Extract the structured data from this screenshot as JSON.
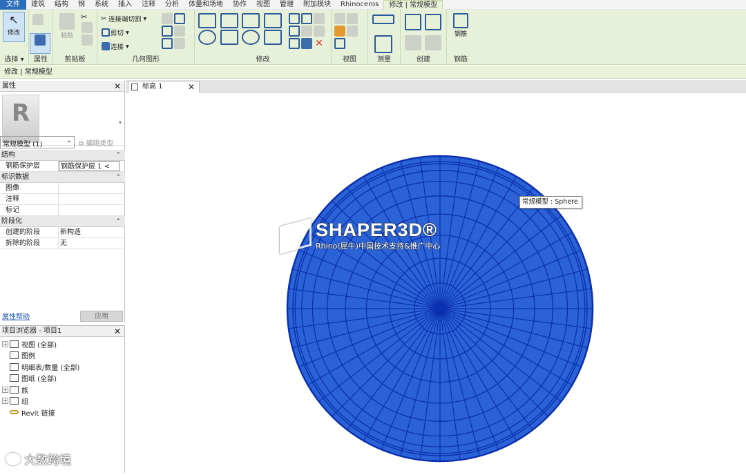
{
  "menubar": {
    "tabs": [
      "文件",
      "建筑",
      "结构",
      "钢",
      "系统",
      "插入",
      "注释",
      "分析",
      "体量和场地",
      "协作",
      "视图",
      "管理",
      "附加模块",
      "Rhinoceros",
      "修改 | 常规模型"
    ]
  },
  "ribbon": {
    "modify_label": "修改",
    "paste_label": "粘贴",
    "join_cut": "连接端切割",
    "cut": "剪切",
    "join": "连接",
    "rebar_label": "钢筋",
    "panels": [
      "选择",
      "属性",
      "剪贴板",
      "几何图形",
      "修改",
      "视图",
      "测量",
      "创建",
      "钢筋"
    ],
    "select_dropdown": "▾"
  },
  "statusbar": {
    "context": "修改 | 常规模型"
  },
  "properties": {
    "title": "属性",
    "type_selector": "常规模型 (1)",
    "edit_type": "编辑类型",
    "categories": {
      "structure": "结构",
      "identity": "标识数据",
      "phasing": "阶段化"
    },
    "rows": {
      "rebar_cover": {
        "key": "钢筋保护层",
        "value": "钢筋保护层 1 <"
      },
      "image": {
        "key": "图像",
        "value": ""
      },
      "comments": {
        "key": "注释",
        "value": ""
      },
      "mark": {
        "key": "标记",
        "value": ""
      },
      "phase_created": {
        "key": "创建的阶段",
        "value": "新构造"
      },
      "phase_demolished": {
        "key": "拆除的阶段",
        "value": "无"
      }
    },
    "help_link": "属性帮助",
    "apply": "应用"
  },
  "browser": {
    "title": "项目浏览器 - 项目1",
    "items": [
      "视图 (全部)",
      "图例",
      "明细表/数量 (全部)",
      "图纸 (全部)",
      "族",
      "组",
      "Revit 链接"
    ]
  },
  "view": {
    "tab_label": "标高 1",
    "tooltip": "常规模型 : Sphere",
    "sphere_fill": "#2b63d6",
    "sphere_line": "#0a2fb0"
  },
  "watermark": {
    "brand": "SHAPER3D®",
    "subtitle": "Rhino(犀牛)中国技术支持&推广中心",
    "corner": "大数跨境"
  }
}
